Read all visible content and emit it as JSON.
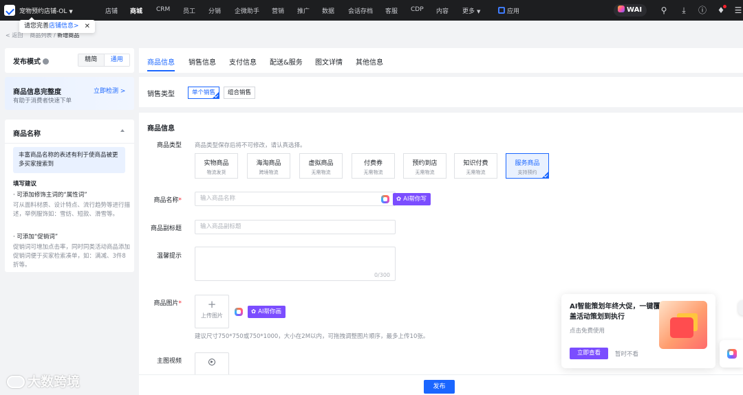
{
  "topbar": {
    "store_name": "宠物预约店铺-OL",
    "nav": [
      "店铺",
      "商城",
      "CRM",
      "员工",
      "分销",
      "企微助手",
      "营销",
      "推广",
      "数据",
      "会话存档",
      "客服",
      "CDP",
      "内容",
      "更多"
    ],
    "active_nav": "商城",
    "app_label": "应用",
    "wai_label": "WAI"
  },
  "tooltip": {
    "text": "请您完善",
    "link": "店铺信息",
    "arrow": ">"
  },
  "breadcrumb": {
    "back": "返回",
    "parent": "商品列表",
    "sep": "/",
    "current": "新增商品"
  },
  "left": {
    "mode_title": "发布模式",
    "mode_simple": "精简",
    "mode_general": "通用",
    "completeness_title": "商品信息完整度",
    "completeness_sub": "有助于消费者快速下单",
    "check_link": "立即检测 >",
    "name_title": "商品名称",
    "hint": "丰富商品名称的表述有利于使商品被更多买家搜索到",
    "suggest_title": "填写建议",
    "s1_title": "· 可添加修饰主词的“属性词”",
    "s1_body": "可从面料材质、设计特点、流行趋势等进行描述，举例服饰如：雪纺、短款、滑雪等。",
    "s2_title": "· 可添加“促销词”",
    "s2_body": "促销词可增加点击率，同时同类活动商品添加促销词便于买家检索凑单，如：满减、3件8折等。"
  },
  "tabs": [
    "商品信息",
    "销售信息",
    "支付信息",
    "配送&服务",
    "图文详情",
    "其他信息"
  ],
  "active_tab": "商品信息",
  "sales_type": {
    "label": "销售类型",
    "options": [
      "单个销售",
      "组合销售"
    ],
    "selected": "单个销售"
  },
  "product_info": {
    "title": "商品信息",
    "type_label": "商品类型",
    "type_note": "商品类型保存后将不可修改，请认真选择。",
    "types": [
      {
        "name": "实物商品",
        "sub": "物流发货"
      },
      {
        "name": "海淘商品",
        "sub": "跨境物流"
      },
      {
        "name": "虚拟商品",
        "sub": "无需物流"
      },
      {
        "name": "付费券",
        "sub": "无需物流"
      },
      {
        "name": "预约到店",
        "sub": "无需物流"
      },
      {
        "name": "知识付费",
        "sub": "无需物流"
      },
      {
        "name": "服务商品",
        "sub": "支持预约"
      }
    ],
    "selected_type": "服务商品",
    "name_label": "商品名称",
    "name_placeholder": "输入商品名称",
    "ai_write": "AI帮你写",
    "subtitle_label": "商品副标题",
    "subtitle_placeholder": "输入商品副标题",
    "reminder_label": "温馨提示",
    "reminder_count": "0/300",
    "image_label": "商品图片",
    "upload_label": "上传图片",
    "ai_draw": "AI帮你画",
    "image_note": "建议尺寸750*750或750*1000，大小在2M以内，可拖拽调整图片顺序，最多上传10张。",
    "video_label": "主图视频"
  },
  "footer": {
    "publish": "发布"
  },
  "promo": {
    "title": "AI智能策划年终大促，一键覆盖活动策划到执行",
    "sub": "点击免费使用",
    "go": "立即查看",
    "dismiss": "暂时不看"
  },
  "watermark": "大数跨境"
}
